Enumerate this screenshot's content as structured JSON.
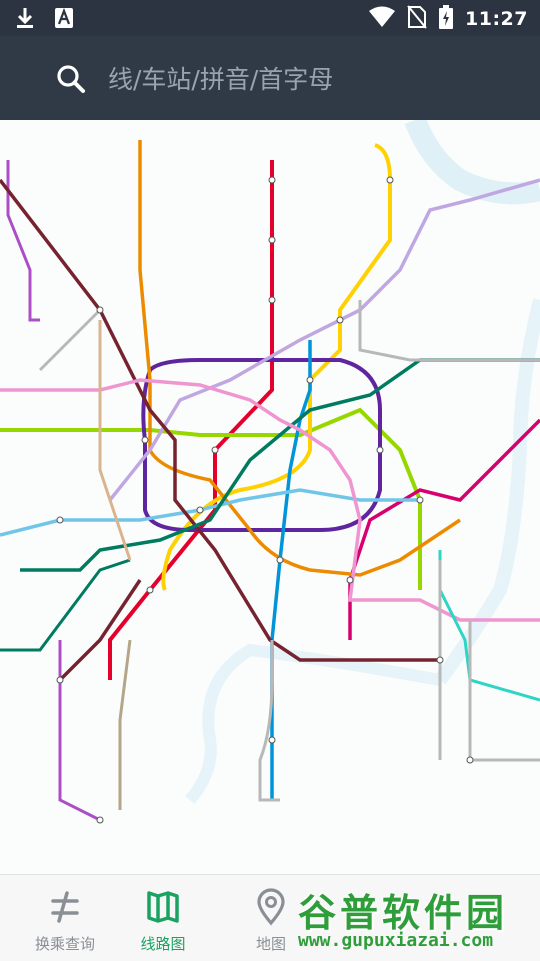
{
  "status_bar": {
    "time": "11:27",
    "icons": [
      "download-icon",
      "font-app-icon",
      "wifi-icon",
      "no-sim-icon",
      "battery-charging-icon"
    ]
  },
  "search": {
    "placeholder": "线/车站/拼音/首字母",
    "value": ""
  },
  "map": {
    "description_icon": "metro-network-map",
    "line_colors": {
      "line1": "#e4002b",
      "line2": "#97d700",
      "line3": "#ffd100",
      "line4": "#5f259f",
      "line5": "#ac4fc6",
      "line6": "#d6006f",
      "line7": "#ed8b00",
      "line8": "#0094d8",
      "line9": "#71c5e8",
      "line10": "#c1a7e2",
      "line11": "#76232f",
      "line12": "#007b5f",
      "line13": "#ef95cf",
      "line15": "#b5a589",
      "line16": "#2cd5c4",
      "line17": "#c4a08a",
      "line18": "#d9b48f",
      "pujiang": "#b8b8b8"
    }
  },
  "bottom_nav": {
    "items": [
      {
        "label": "换乘查询",
        "icon": "transfer-icon",
        "active": false
      },
      {
        "label": "线路图",
        "icon": "map-book-icon",
        "active": true
      },
      {
        "label": "地图",
        "icon": "location-pin-icon",
        "active": false
      }
    ]
  },
  "watermark": {
    "title": "谷普软件园",
    "url": "www.gupuxiazai.com"
  }
}
